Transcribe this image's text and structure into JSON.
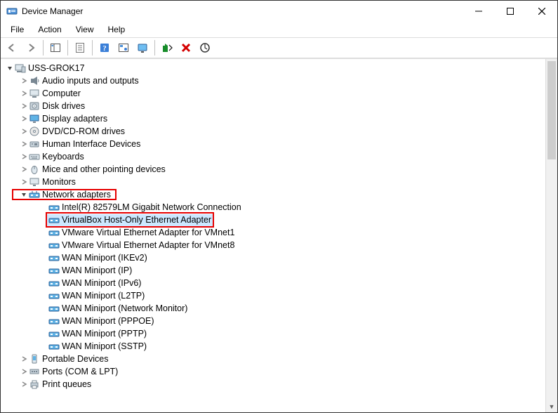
{
  "window": {
    "title": "Device Manager"
  },
  "menubar": {
    "items": [
      "File",
      "Action",
      "View",
      "Help"
    ]
  },
  "tree": {
    "root": "USS-GROK17",
    "categories": [
      {
        "label": "Audio inputs and outputs",
        "icon": "audio"
      },
      {
        "label": "Computer",
        "icon": "computer"
      },
      {
        "label": "Disk drives",
        "icon": "disk"
      },
      {
        "label": "Display adapters",
        "icon": "display"
      },
      {
        "label": "DVD/CD-ROM drives",
        "icon": "dvd"
      },
      {
        "label": "Human Interface Devices",
        "icon": "hid"
      },
      {
        "label": "Keyboards",
        "icon": "keyboard"
      },
      {
        "label": "Mice and other pointing devices",
        "icon": "mouse"
      },
      {
        "label": "Monitors",
        "icon": "monitor"
      }
    ],
    "network_category": "Network adapters",
    "network_adapters": [
      "Intel(R) 82579LM Gigabit Network Connection",
      "VirtualBox Host-Only Ethernet Adapter",
      "VMware Virtual Ethernet Adapter for VMnet1",
      "VMware Virtual Ethernet Adapter for VMnet8",
      "WAN Miniport (IKEv2)",
      "WAN Miniport (IP)",
      "WAN Miniport (IPv6)",
      "WAN Miniport (L2TP)",
      "WAN Miniport (Network Monitor)",
      "WAN Miniport (PPPOE)",
      "WAN Miniport (PPTP)",
      "WAN Miniport (SSTP)"
    ],
    "tail_categories": [
      {
        "label": "Portable Devices",
        "icon": "portable"
      },
      {
        "label": "Ports (COM & LPT)",
        "icon": "ports"
      },
      {
        "label": "Print queues",
        "icon": "print"
      }
    ],
    "selected_index": 1
  }
}
